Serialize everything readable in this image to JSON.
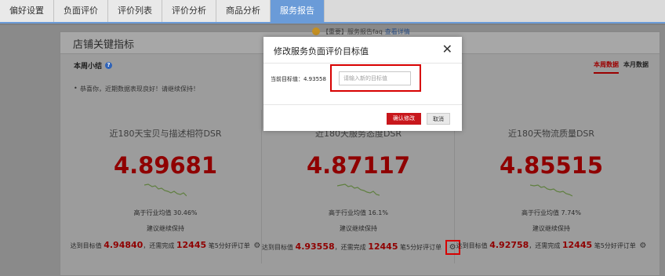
{
  "tabs": [
    {
      "label": "偏好设置",
      "active": false
    },
    {
      "label": "负面评价",
      "active": false
    },
    {
      "label": "评价列表",
      "active": false
    },
    {
      "label": "评价分析",
      "active": false
    },
    {
      "label": "商品分析",
      "active": false
    },
    {
      "label": "服务报告",
      "active": true
    }
  ],
  "panel": {
    "title": "店铺关键指标"
  },
  "notice": {
    "text": "【重要】服务报告faq",
    "link": "查看详情"
  },
  "summary": {
    "title": "本周小结",
    "text": "恭喜你，近期数据表现良好！请继续保持！"
  },
  "period_tabs": [
    {
      "label": "本周数据",
      "active": true
    },
    {
      "label": "本月数据",
      "active": false
    }
  ],
  "cards": [
    {
      "title": "近180天宝贝与描述相符DSR",
      "score": "4.89681",
      "compare": "高于行业均值 30.46%",
      "advice": "建议继续保持",
      "target_prefix": "达到目标值",
      "target_value": "4.94840",
      "target_mid": "，还需完成",
      "target_count": "12445",
      "target_suffix": "笔5分好评订单"
    },
    {
      "title": "近180天服务态度DSR",
      "score": "4.87117",
      "compare": "高于行业均值 16.1%",
      "advice": "建议继续保持",
      "target_prefix": "达到目标值",
      "target_value": "4.93558",
      "target_mid": "，还需完成",
      "target_count": "12445",
      "target_suffix": "笔5分好评订单"
    },
    {
      "title": "近180天物流质量DSR",
      "score": "4.85515",
      "compare": "高于行业均值 7.74%",
      "advice": "建议继续保持",
      "target_prefix": "达到目标值",
      "target_value": "4.92758",
      "target_mid": "，还需完成",
      "target_count": "12445",
      "target_suffix": "笔5分好评订单"
    }
  ],
  "modal": {
    "title": "修改服务负面评价目标值",
    "current_label": "当前目标值：4.93558",
    "input_placeholder": "请输入新的目标值",
    "input_value": "",
    "confirm_label": "确认修改",
    "cancel_label": "取消"
  },
  "colors": {
    "tab_active": "#6a9bd8",
    "score": "#8f0000",
    "confirm": "#c8171c",
    "highlight": "#d70000",
    "sparkline": "#5f7f3f"
  }
}
